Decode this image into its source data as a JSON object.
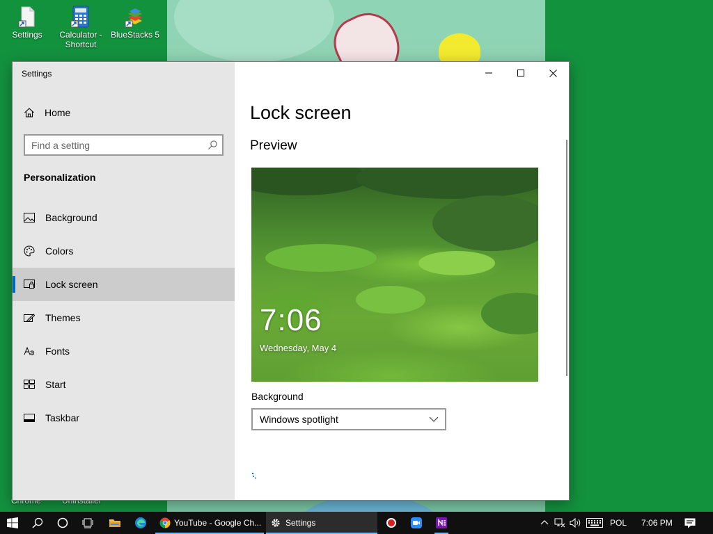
{
  "desktop": {
    "icons": [
      {
        "label": "Settings"
      },
      {
        "label": "Calculator - Shortcut"
      },
      {
        "label": "BlueStacks 5"
      }
    ],
    "bottom_labels": [
      "Chrome",
      "Uninstaller"
    ]
  },
  "window": {
    "title": "Settings",
    "caption": {
      "minimize": "minimize",
      "maximize": "maximize",
      "close": "close"
    }
  },
  "sidebar": {
    "home_label": "Home",
    "search_placeholder": "Find a setting",
    "section_title": "Personalization",
    "items": [
      {
        "label": "Background",
        "icon": "image-icon"
      },
      {
        "label": "Colors",
        "icon": "palette-icon"
      },
      {
        "label": "Lock screen",
        "icon": "lock-screen-icon",
        "selected": true
      },
      {
        "label": "Themes",
        "icon": "themes-icon"
      },
      {
        "label": "Fonts",
        "icon": "fonts-icon"
      },
      {
        "label": "Start",
        "icon": "start-icon"
      },
      {
        "label": "Taskbar",
        "icon": "taskbar-icon"
      }
    ]
  },
  "content": {
    "page_title": "Lock screen",
    "preview_title": "Preview",
    "preview_time": "7:06",
    "preview_date": "Wednesday, May 4",
    "background_label": "Background",
    "background_value": "Windows spotlight"
  },
  "taskbar": {
    "apps": [
      {
        "label": "YouTube - Google Ch..."
      },
      {
        "label": "Settings"
      }
    ],
    "tray": {
      "language": "POL",
      "time": "7:06 PM"
    }
  },
  "colors": {
    "desktop": "#13923e",
    "accent": "#0067c0",
    "taskbar": "#101010"
  }
}
